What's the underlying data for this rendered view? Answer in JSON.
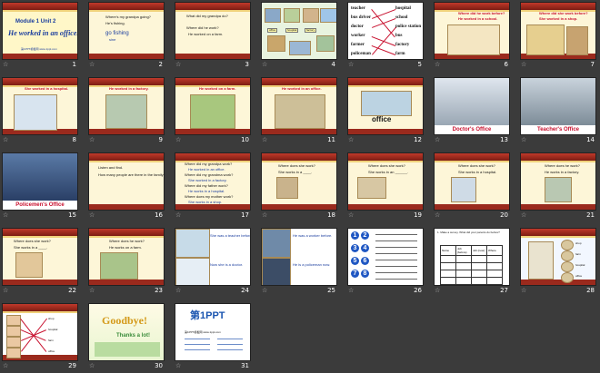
{
  "slide_numbers": [
    "1",
    "2",
    "3",
    "4",
    "5",
    "6",
    "7",
    "8",
    "9",
    "10",
    "11",
    "12",
    "13",
    "14",
    "15",
    "16",
    "17",
    "18",
    "19",
    "20",
    "21",
    "22",
    "23",
    "24",
    "25",
    "26",
    "27",
    "28",
    "29",
    "30",
    "31"
  ],
  "star_glyph": "☆",
  "s1": {
    "title": "Module 1 Unit 2",
    "subtitle": "He worked in an office.",
    "footer": "第1PPT模板网 www.1ppt.com"
  },
  "s2": {
    "q": "Where's my grandpa going?",
    "a": "He's fishing.",
    "gone": "go fishing",
    "pl": "sine"
  },
  "s3": {
    "q": "What did my grandpa do?",
    "q2": "Where did he work?",
    "a": "He worked on a farm."
  },
  "s4": {
    "labels": [
      "office",
      "hospital",
      "factory",
      "school",
      "shop"
    ]
  },
  "s5": {
    "left": [
      "teacher",
      "bus driver",
      "doctor",
      "worker",
      "farmer",
      "policeman"
    ],
    "right": [
      "hospital",
      "school",
      "police station",
      "bus",
      "factory",
      "farm"
    ]
  },
  "s6": {
    "q": "Where did he work before?",
    "a": "He worked in a school."
  },
  "s7": {
    "q": "Where did she work before?",
    "a": "She worked in a shop."
  },
  "s8": {
    "a": "She worked in a hospital."
  },
  "s9": {
    "a": "He worked in a factory."
  },
  "s10": {
    "a": "He worked on a farm."
  },
  "s11": {
    "a": "He worked in an office."
  },
  "s12": {
    "a": "office"
  },
  "s13": {
    "caption": "Doctor's Office"
  },
  "s14": {
    "caption": "Teacher's Office"
  },
  "s15": {
    "caption": "Policemen's Office"
  },
  "s16": {
    "l1": "Listen and find.",
    "l2": "How many people are there in the family?"
  },
  "s17": {
    "lines": [
      "Where did my grandpa work?",
      "He worked in an office.",
      "Where did my grandma work?",
      "She worked in a factory.",
      "Where did my father work?",
      "He works in a hospital.",
      "Where does my mother work?",
      "She works in a shop."
    ]
  },
  "s18": {
    "q": "Where does she work?",
    "a": "She works in a ____."
  },
  "s19": {
    "q": "Where does she work?",
    "a": "She works in an ______."
  },
  "s20": {
    "q": "Where does she work?",
    "a": "She works in a hospital."
  },
  "s21": {
    "q": "Where does he work?",
    "a": "He works in a factory."
  },
  "s22": {
    "q": "Where does she work?",
    "a": "She works in a ____."
  },
  "s23": {
    "q": "Where does he work?",
    "a": "He works on a farm."
  },
  "s24": {
    "l1": "She was a teacher before.",
    "l2": "Now she is a doctor."
  },
  "s25": {
    "l1": "He was a worker before.",
    "l2": "He is a policeman now."
  },
  "s26": {
    "nums": [
      "1",
      "2",
      "3",
      "4",
      "5",
      "6",
      "7",
      "8"
    ]
  },
  "s27": {
    "l1": "1. Make a survey. What did your parents do before?",
    "head": [
      "Name",
      "Job (before)",
      "Job (now)",
      "Where"
    ]
  },
  "s28": {
    "words": [
      "shop",
      "farm",
      "hospital",
      "office"
    ]
  },
  "s29": {
    "words": [
      "shop",
      "hospital",
      "farm",
      "office"
    ]
  },
  "s30": {
    "title": "Goodbye!",
    "sub": "Thanks a lot!"
  },
  "s31": {
    "logo": "第1PPT",
    "text": "第1PPT模板网 www.1ppt.com"
  }
}
